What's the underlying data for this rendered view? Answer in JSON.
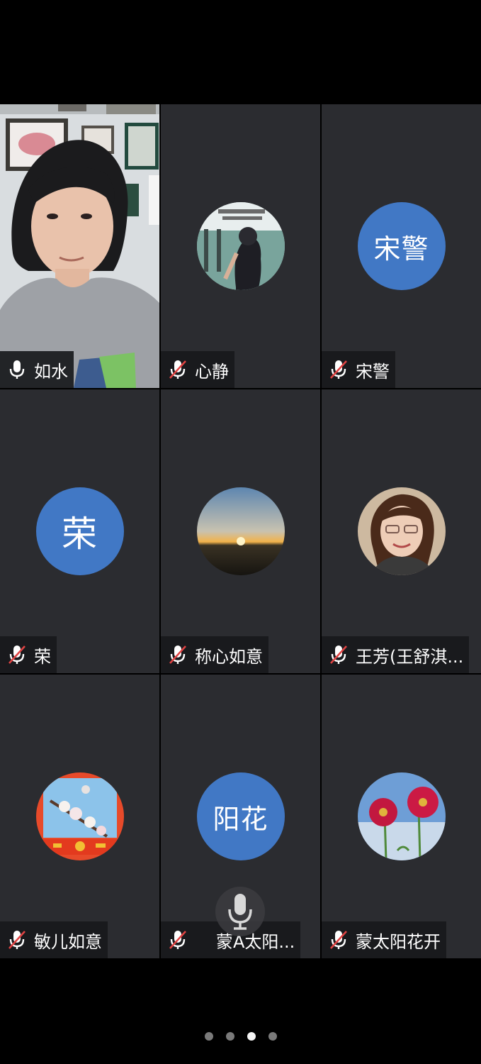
{
  "participants": [
    {
      "name": "如水",
      "muted": false,
      "video": true
    },
    {
      "name": "心静",
      "muted": true,
      "avatar_type": "photo"
    },
    {
      "name": "宋警",
      "muted": true,
      "avatar_type": "text",
      "avatar_text": "宋警"
    },
    {
      "name": "荣",
      "muted": true,
      "avatar_type": "text",
      "avatar_text": "荣"
    },
    {
      "name": "称心如意",
      "muted": true,
      "avatar_type": "photo"
    },
    {
      "name": "王芳(王舒淇...",
      "muted": true,
      "avatar_type": "photo"
    },
    {
      "name": "敏儿如意",
      "muted": true,
      "avatar_type": "photo"
    },
    {
      "name": "蒙A太阳...",
      "muted": true,
      "avatar_type": "text",
      "avatar_text": "阳花"
    },
    {
      "name": "蒙太阳花开",
      "muted": true,
      "avatar_type": "photo"
    }
  ],
  "avatar_accent": "#4178c5",
  "tile_background": "#2b2c30",
  "pagination": {
    "pages": 4,
    "current": 3
  }
}
